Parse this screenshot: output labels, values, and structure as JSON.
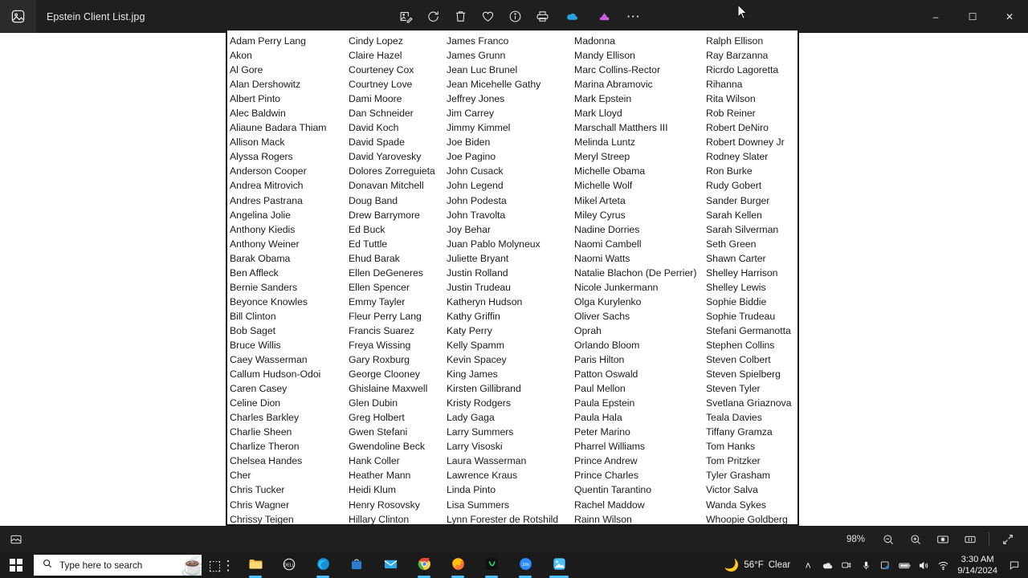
{
  "window": {
    "title": "Epstein Client List.jpg",
    "app_icon": "photos-app-icon",
    "controls": {
      "minimize": "–",
      "maximize": "☐",
      "close": "✕"
    },
    "toolbar": [
      {
        "name": "edit-image-icon",
        "label": "Edit image"
      },
      {
        "name": "rotate-icon",
        "label": "Rotate"
      },
      {
        "name": "delete-icon",
        "label": "Delete"
      },
      {
        "name": "favorite-heart-icon",
        "label": "Add to favorites"
      },
      {
        "name": "info-icon",
        "label": "File info"
      },
      {
        "name": "print-icon",
        "label": "Print"
      },
      {
        "name": "onedrive-icon",
        "label": "OneDrive"
      },
      {
        "name": "designer-icon",
        "label": "Designer"
      },
      {
        "name": "more-options-icon",
        "label": "See more"
      }
    ]
  },
  "statusbar": {
    "gallery_icon": "gallery-icon",
    "zoom_level": "98%",
    "zoom_out_icon": "zoom-out-icon",
    "zoom_in_icon": "zoom-in-icon",
    "fit_icon": "fit-to-window-icon",
    "filmstrip_icon": "filmstrip-icon",
    "fullscreen_icon": "fullscreen-icon"
  },
  "taskbar": {
    "start_label": "Start",
    "search": {
      "placeholder": "Type here to search",
      "icon": "search-icon"
    },
    "items": [
      {
        "name": "task-view",
        "glyph": "⌸",
        "label": "Task View"
      },
      {
        "name": "file-explorer",
        "glyph": "📁",
        "label": "File Explorer"
      },
      {
        "name": "dell-app",
        "glyph": "DELL",
        "label": "Dell"
      },
      {
        "name": "microsoft-edge",
        "glyph": "e",
        "label": "Microsoft Edge"
      },
      {
        "name": "microsoft-store",
        "glyph": "🛍",
        "label": "Microsoft Store"
      },
      {
        "name": "mail",
        "glyph": "✉",
        "label": "Mail"
      },
      {
        "name": "google-chrome",
        "glyph": "●",
        "label": "Google Chrome"
      },
      {
        "name": "mozilla-firefox",
        "glyph": "●",
        "label": "Firefox"
      },
      {
        "name": "whatsapp",
        "glyph": "W",
        "label": "WhatsApp"
      },
      {
        "name": "zoom",
        "glyph": "zm",
        "label": "Zoom"
      },
      {
        "name": "photos",
        "glyph": "🖼",
        "label": "Photos"
      }
    ],
    "tray": {
      "weather": {
        "icon": "moon-icon",
        "temperature": "56°F",
        "condition": "Clear"
      },
      "chevron": "˄",
      "icons": [
        {
          "name": "onedrive-tray-icon"
        },
        {
          "name": "camera-tray-icon"
        },
        {
          "name": "microphone-tray-icon"
        },
        {
          "name": "teams-tray-icon"
        },
        {
          "name": "battery-tray-icon"
        },
        {
          "name": "volume-tray-icon"
        },
        {
          "name": "wifi-tray-icon"
        }
      ],
      "clock": {
        "time": "3:30 AM",
        "date": "9/14/2024"
      },
      "notification_icon": "notification-bell-icon"
    }
  },
  "document": {
    "columns": [
      {
        "names": [
          "Adam Perry Lang",
          "Akon",
          "Al Gore",
          "Alan Dershowitz",
          "Albert Pinto",
          "Alec Baldwin",
          "Aliaune Badara Thiam",
          "Allison Mack",
          "Alyssa Rogers",
          "Anderson Cooper",
          "Andrea Mitrovich",
          "Andres Pastrana",
          "Angelina Jolie",
          "Anthony Kiedis",
          "Anthony Weiner",
          "Barak Obama",
          "Ben Affleck",
          "Bernie Sanders",
          "Beyonce Knowles",
          "Bill Clinton",
          "Bob Saget",
          "Bruce Willis",
          "Caey Wasserman",
          "Callum Hudson-Odoi",
          "Caren Casey",
          "Celine Dion",
          "Charles Barkley",
          "Charlie Sheen",
          "Charlize Theron",
          "Chelsea Handes",
          "Cher",
          "Chris Tucker",
          "Chris Wagner",
          "Chrissy Teigen"
        ]
      },
      {
        "names": [
          "Cindy Lopez",
          "Claire Hazel",
          "Courteney Cox",
          "Courtney Love",
          "Dami Moore",
          "Dan Schneider",
          "David Koch",
          "David Spade",
          "David Yarovesky",
          "Dolores Zorreguieta",
          "Donavan Mitchell",
          "Doug Band",
          "Drew Barrymore",
          "Ed Buck",
          "Ed Tuttle",
          "Ehud Barak",
          "Ellen DeGeneres",
          "Ellen Spencer",
          "Emmy Tayler",
          "Fleur Perry Lang",
          "Francis Suarez",
          "Freya Wissing",
          "Gary Roxburg",
          "George Clooney",
          "Ghislaine Maxwell",
          "Glen Dubin",
          "Greg Holbert",
          "Gwen Stefani",
          "Gwendoline Beck",
          "Hank Coller",
          "Heather Mann",
          "Heidi Klum",
          "Henry Rosovsky",
          "Hillary Clinton"
        ]
      },
      {
        "names": [
          "James Franco",
          "James Grunn",
          "Jean Luc Brunel",
          "Jean Micehelle Gathy",
          "Jeffrey Jones",
          "Jim Carrey",
          "Jimmy Kimmel",
          "Joe Biden",
          "Joe Pagino",
          "John Cusack",
          "John Legend",
          "John Podesta",
          "John Travolta",
          "Joy Behar",
          "Juan Pablo Molyneux",
          "Juliette Bryant",
          "Justin Rolland",
          "Justin Trudeau",
          "Katheryn Hudson",
          "Kathy Griffin",
          "Katy Perry",
          "Kelly Spamm",
          "Kevin Spacey",
          "King James",
          "Kirsten Gillibrand",
          "Kristy Rodgers",
          "Lady Gaga",
          "Larry Summers",
          "Larry Visoski",
          "Laura Wasserman",
          "Lawrence Kraus",
          "Linda Pinto",
          "Lisa Summers",
          "Lynn Forester de Rotshild"
        ]
      },
      {
        "names": [
          "Madonna",
          "Mandy Ellison",
          "Marc Collins-Rector",
          "Marina Abramovic",
          "Mark Epstein",
          "Mark Lloyd",
          "Marschall Matthers III",
          "Melinda Luntz",
          "Meryl Streep",
          "Michelle Obama",
          "Michelle Wolf",
          "Mikel Arteta",
          "Miley Cyrus",
          "Nadine Dorries",
          "Naomi Cambell",
          "Naomi Watts",
          "Natalie Blachon (De Perrier)",
          "Nicole Junkermann",
          "Olga Kurylenko",
          "Oliver Sachs",
          "Oprah",
          "Orlando Bloom",
          "Paris Hilton",
          "Patton Oswald",
          "Paul Mellon",
          "Paula Epstein",
          "Paula Hala",
          "Peter Marino",
          "Pharrel Williams",
          "Prince Andrew",
          "Prince Charles",
          "Quentin Tarantino",
          "Rachel Maddow",
          "Rainn Wilson"
        ]
      },
      {
        "names": [
          "Ralph Ellison",
          "Ray Barzanna",
          "Ricrdo Lagoretta",
          "Rihanna",
          "Rita Wilson",
          "Rob Reiner",
          "Robert DeNiro",
          "Robert Downey Jr",
          "Rodney Slater",
          "Ron Burke",
          "Rudy Gobert",
          "Sander Burger",
          "Sarah Kellen",
          "Sarah Silverman",
          "Seth Green",
          "Shawn Carter",
          "Shelley Harrison",
          "Shelley Lewis",
          "Sophie Biddie",
          "Sophie Trudeau",
          "Stefani Germanotta",
          "Stephen Collins",
          "Steven Colbert",
          "Steven Spielberg",
          "Steven Tyler",
          "Svetlana Griaznova",
          "Teala Davies",
          "Tiffany Gramza",
          "Tom Hanks",
          "Tom Pritzker",
          "Tyler Grasham",
          "Victor Salva",
          "Wanda Sykes",
          "Whoopie Goldberg"
        ]
      }
    ]
  }
}
